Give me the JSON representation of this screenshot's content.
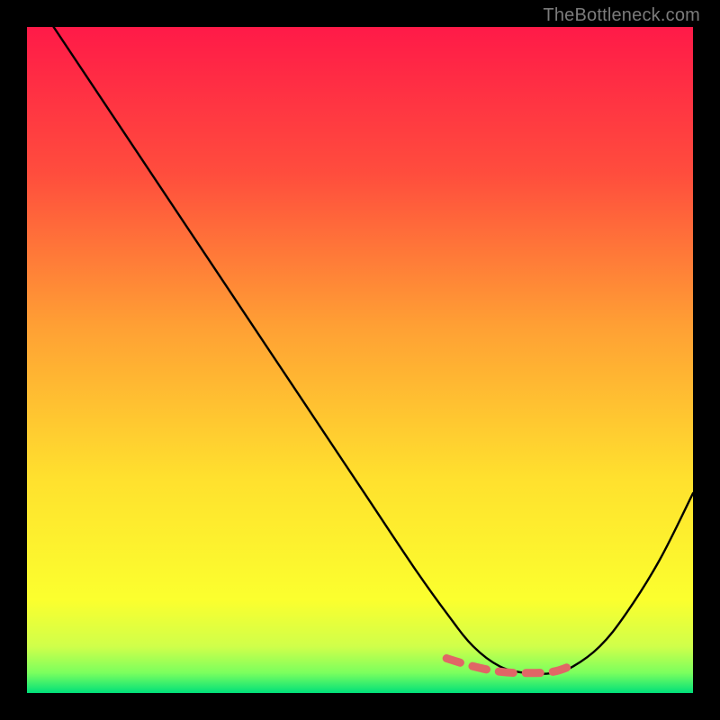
{
  "attribution": "TheBottleneck.com",
  "chart_data": {
    "type": "line",
    "title": "",
    "xlabel": "",
    "ylabel": "",
    "xlim": [
      0,
      100
    ],
    "ylim": [
      0,
      100
    ],
    "gradient_stops": [
      {
        "offset": 0,
        "color": "#ff1a48"
      },
      {
        "offset": 22,
        "color": "#ff4d3d"
      },
      {
        "offset": 45,
        "color": "#ffa034"
      },
      {
        "offset": 68,
        "color": "#ffe12e"
      },
      {
        "offset": 86,
        "color": "#fbff2e"
      },
      {
        "offset": 93,
        "color": "#d0ff4a"
      },
      {
        "offset": 97,
        "color": "#7aff5e"
      },
      {
        "offset": 100,
        "color": "#00e07a"
      }
    ],
    "series": [
      {
        "name": "bottleneck-curve",
        "x": [
          4,
          10,
          20,
          30,
          40,
          50,
          58,
          63,
          67,
          71,
          75,
          79,
          82,
          86,
          90,
          95,
          100
        ],
        "values": [
          100,
          91,
          76,
          61,
          46,
          31,
          19,
          12,
          7,
          4,
          3,
          3,
          4,
          7,
          12,
          20,
          30
        ]
      },
      {
        "name": "optimal-marker",
        "x": [
          63,
          67,
          71,
          75,
          79,
          82
        ],
        "values": [
          5.2,
          4.0,
          3.2,
          3.0,
          3.2,
          4.2
        ]
      }
    ]
  }
}
